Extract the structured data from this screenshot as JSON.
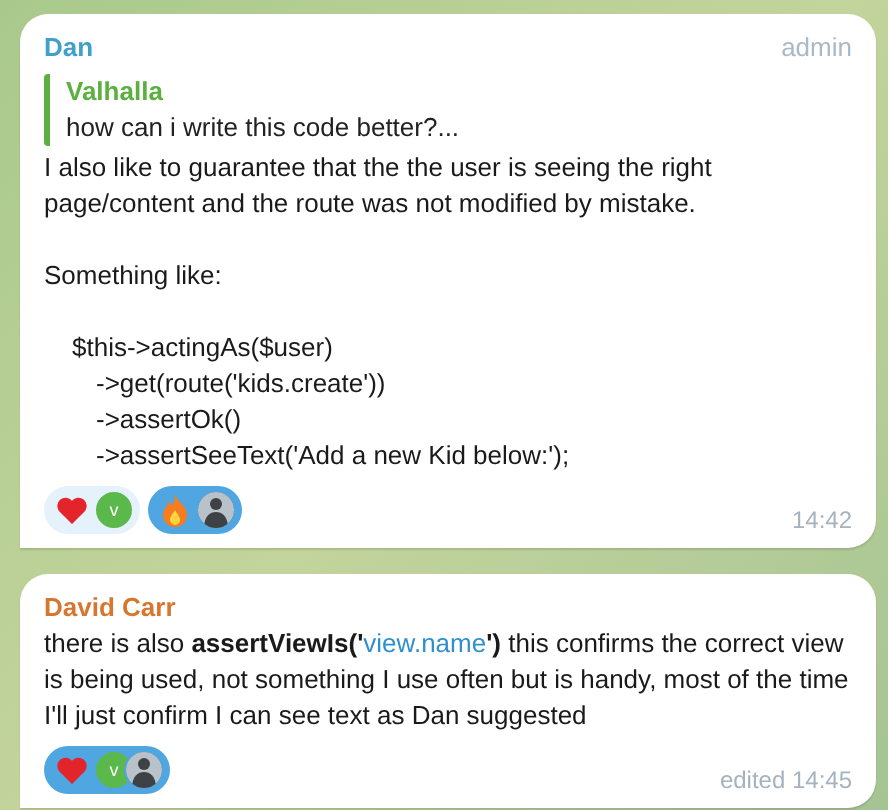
{
  "messages": [
    {
      "author": "Dan",
      "color": "#3fa0c8",
      "badge": "admin",
      "reply": {
        "author": "Valhalla",
        "text": "how can i write this code better?..."
      },
      "paragraphs": [
        "I also like to guarantee that the the user is seeing the right page/content and the route was not modified by mistake.",
        "Something like:"
      ],
      "code": [
        {
          "line": "$this->actingAs($user)",
          "children": [
            {
              "line": "->get(route('kids.create'))"
            },
            {
              "line": "->assertOk()"
            },
            {
              "line": "->assertSeeText('Add a new Kid below:');"
            }
          ]
        }
      ],
      "reactions": [
        {
          "kind": "heart",
          "selected": false,
          "avatars": [
            {
              "kind": "letter",
              "letter": "v",
              "color": "#5bb84a"
            }
          ]
        },
        {
          "kind": "fire",
          "selected": true,
          "avatars": [
            {
              "kind": "photo"
            }
          ]
        }
      ],
      "time": "14:42"
    },
    {
      "author": "David Carr",
      "color": "#d7772f",
      "segments": [
        {
          "kind": "plain",
          "text": "there is also "
        },
        {
          "kind": "bold",
          "text": "assertViewIs('"
        },
        {
          "kind": "link",
          "text": "view.name"
        },
        {
          "kind": "bold",
          "text": "')"
        },
        {
          "kind": "plain",
          "text": " this confirms the correct view is being used, not something I use often but is handy, most of the time I'll just confirm I can see text as Dan suggested"
        }
      ],
      "reactions": [
        {
          "kind": "heart",
          "selected": true,
          "avatars": [
            {
              "kind": "letter",
              "letter": "v",
              "color": "#5bb84a"
            },
            {
              "kind": "photo"
            }
          ]
        }
      ],
      "time": "edited 14:45"
    }
  ]
}
